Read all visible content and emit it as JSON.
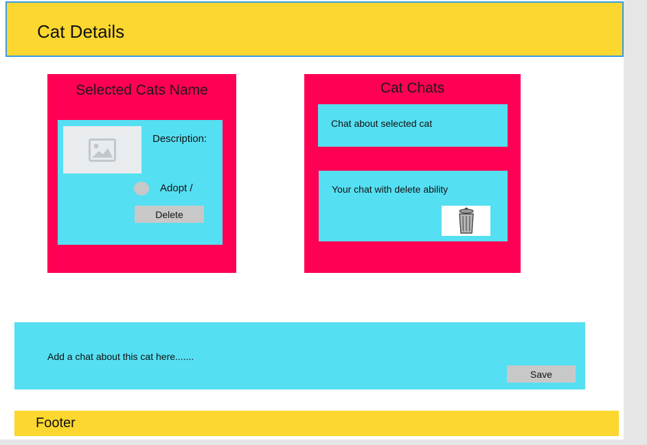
{
  "header": {
    "title": "Cat Details"
  },
  "cat_panel": {
    "title": "Selected Cats Name",
    "description_label": "Description:",
    "adopt_label": "Adopt /",
    "delete_label": "Delete",
    "image_icon": "image-placeholder-icon"
  },
  "chats_panel": {
    "title": "Cat Chats",
    "chat_about_cat": "Chat about selected cat",
    "your_chat": "Your chat with delete ability",
    "trash_icon": "trash-can-icon"
  },
  "compose": {
    "placeholder": "Add a chat about this cat here.......",
    "save_label": "Save"
  },
  "footer": {
    "text": "Footer"
  },
  "colors": {
    "header": "#fcd72f",
    "panel": "#ff0054",
    "card": "#55dff2",
    "button": "#c8c8c8"
  }
}
